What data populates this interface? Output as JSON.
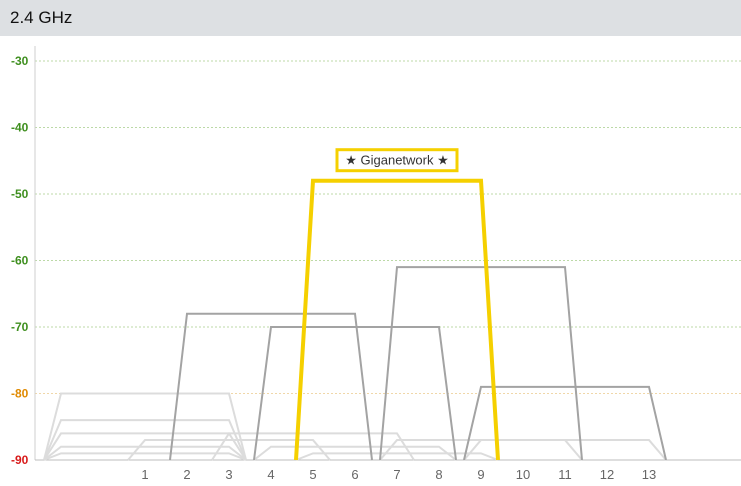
{
  "header": {
    "title": "2.4 GHz"
  },
  "chart_data": {
    "type": "line",
    "x_ticks": [
      1,
      2,
      3,
      4,
      5,
      6,
      7,
      8,
      9,
      10,
      11,
      12,
      13
    ],
    "ylim": [
      -90,
      -25
    ],
    "y_ticks": [
      {
        "value": -30,
        "label": "-30",
        "color": "#3f8f1f"
      },
      {
        "value": -40,
        "label": "-40",
        "color": "#3f8f1f"
      },
      {
        "value": -50,
        "label": "-50",
        "color": "#3f8f1f"
      },
      {
        "value": -60,
        "label": "-60",
        "color": "#3f8f1f"
      },
      {
        "value": -70,
        "label": "-70",
        "color": "#3f8f1f"
      },
      {
        "value": -80,
        "label": "-80",
        "color": "#e08a00"
      },
      {
        "value": -90,
        "label": "-90",
        "color": "#d81a1a"
      }
    ],
    "networks": [
      {
        "name": "Giganetwork",
        "label": "★ Giganetwork ★",
        "highlight": true,
        "channel": 7,
        "level": -48,
        "color": "#f5d000"
      },
      {
        "channel": 4,
        "level": -68,
        "color": "#a3a3a3"
      },
      {
        "channel": 6,
        "level": -70,
        "color": "#a3a3a3"
      },
      {
        "channel": 9,
        "level": -61,
        "color": "#a3a3a3"
      },
      {
        "channel": 11,
        "level": -79,
        "color": "#a3a3a3"
      },
      {
        "channel": 1,
        "level": -80,
        "color": "#dcdcdc"
      },
      {
        "channel": 1,
        "level": -84,
        "color": "#dcdcdc"
      },
      {
        "channel": 1,
        "level": -86,
        "color": "#dcdcdc"
      },
      {
        "channel": 1,
        "level": -88,
        "color": "#dcdcdc"
      },
      {
        "channel": 1,
        "level": -89,
        "color": "#dcdcdc"
      },
      {
        "channel": 3,
        "level": -87,
        "color": "#dcdcdc"
      },
      {
        "channel": 5,
        "level": -86,
        "color": "#dcdcdc"
      },
      {
        "channel": 6,
        "level": -88,
        "color": "#dcdcdc"
      },
      {
        "channel": 7,
        "level": -89,
        "color": "#dcdcdc"
      },
      {
        "channel": 9,
        "level": -87,
        "color": "#dcdcdc"
      },
      {
        "channel": 11,
        "level": -87,
        "color": "#dcdcdc"
      }
    ]
  }
}
